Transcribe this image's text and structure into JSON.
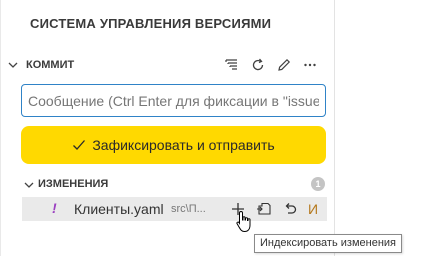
{
  "panel": {
    "title": "СИСТЕМА УПРАВЛЕНИЯ ВЕРСИЯМИ"
  },
  "commit_section": {
    "label": "КОММИТ",
    "toolbar": [
      {
        "name": "view-as-tree",
        "icon": "list-tree-icon"
      },
      {
        "name": "refresh",
        "icon": "refresh-icon"
      },
      {
        "name": "commit",
        "icon": "pencil-icon"
      },
      {
        "name": "more-actions",
        "icon": "ellipsis-icon"
      }
    ],
    "message_placeholder": "Сообщение (Ctrl Enter для фиксации в \"issue",
    "message_value": "",
    "commit_button_label": "Зафиксировать и отправить"
  },
  "changes_section": {
    "label": "ИЗМЕНЕНИЯ",
    "count": "1",
    "files": [
      {
        "status_glyph": "!",
        "name": "Клиенты.yaml",
        "path": "src\\П...",
        "status_letter": "И"
      }
    ]
  },
  "tooltip": "Индексировать изменения",
  "colors": {
    "accent_border": "#2f83c7",
    "commit_button": "#ffd900",
    "conflict_glyph": "#9b3fc0",
    "modified_letter": "#b5791e"
  }
}
